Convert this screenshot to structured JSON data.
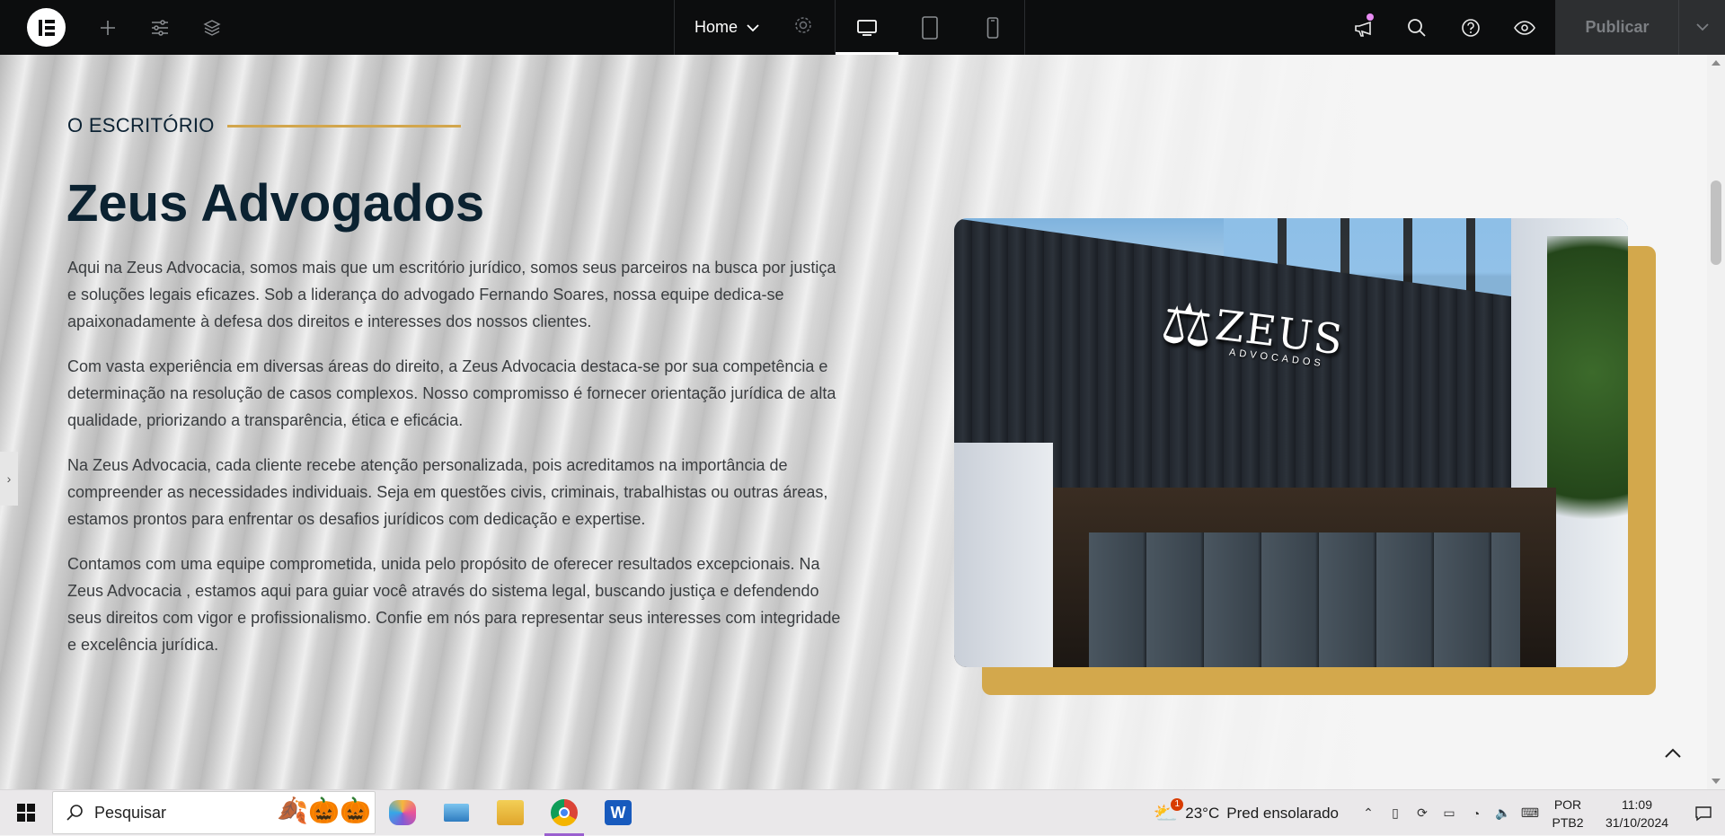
{
  "editor": {
    "page_name": "Home",
    "publish_label": "Publicar"
  },
  "section": {
    "eyebrow": "O ESCRITÓRIO",
    "title": "Zeus Advogados",
    "paragraphs": [
      "Aqui na Zeus Advocacia, somos mais que um escritório jurídico, somos seus parceiros na busca por justiça e soluções legais eficazes. Sob a liderança do advogado Fernando Soares, nossa equipe de­dica-se apaixonadamente à defesa dos direitos e interesses dos nossos clientes.",
      "Com vasta experiência em diversas áreas do direito, a Zeus Advocacia destaca-se por sua competên­cia e determinação na resolução de casos complexos. Nosso compromisso é fornecer orientação jurí­dica de alta qualidade, priorizando a transparência, ética e eficácia.",
      "Na Zeus Advocacia, cada cliente recebe atenção personalizada, pois acreditamos na importância de compreender as necessidades individuais. Seja em questões civis, criminais, trabalhistas ou outras áreas, estamos prontos para enfrentar os desafios jurídicos com dedicação e expertise.",
      "Contamos com uma equipe comprometida, unida pelo propósito de oferecer resultados excepcionais. Na Zeus Advocacia , estamos aqui para guiar você através do sistema legal, buscando justiça e defen­dendo seus direitos com vigor e profissionalismo. Confie em nós para representar seus interesses com integridade e excelência jurídica."
    ],
    "sign_word": "ZEUS",
    "sign_sub": "ADVOCADOS"
  },
  "taskbar": {
    "search_placeholder": "Pesquisar",
    "weather_temp": "23°C",
    "weather_desc": "Pred ensolarado",
    "weather_badge": "1",
    "lang_top": "POR",
    "lang_bottom": "PTB2",
    "time": "11:09",
    "date": "31/10/2024"
  },
  "colors": {
    "accent_gold": "#d3a84c",
    "title_navy": "#0b2231",
    "topbar_bg": "#0c0d0e"
  },
  "icons": {
    "topbar": [
      "elementor-logo-icon",
      "add-icon",
      "sliders-icon",
      "layers-icon",
      "chevron-down-icon",
      "gear-icon",
      "desktop-icon",
      "tablet-icon",
      "mobile-icon",
      "megaphone-icon",
      "search-icon",
      "help-icon",
      "eye-icon",
      "chevron-down-icon"
    ]
  }
}
